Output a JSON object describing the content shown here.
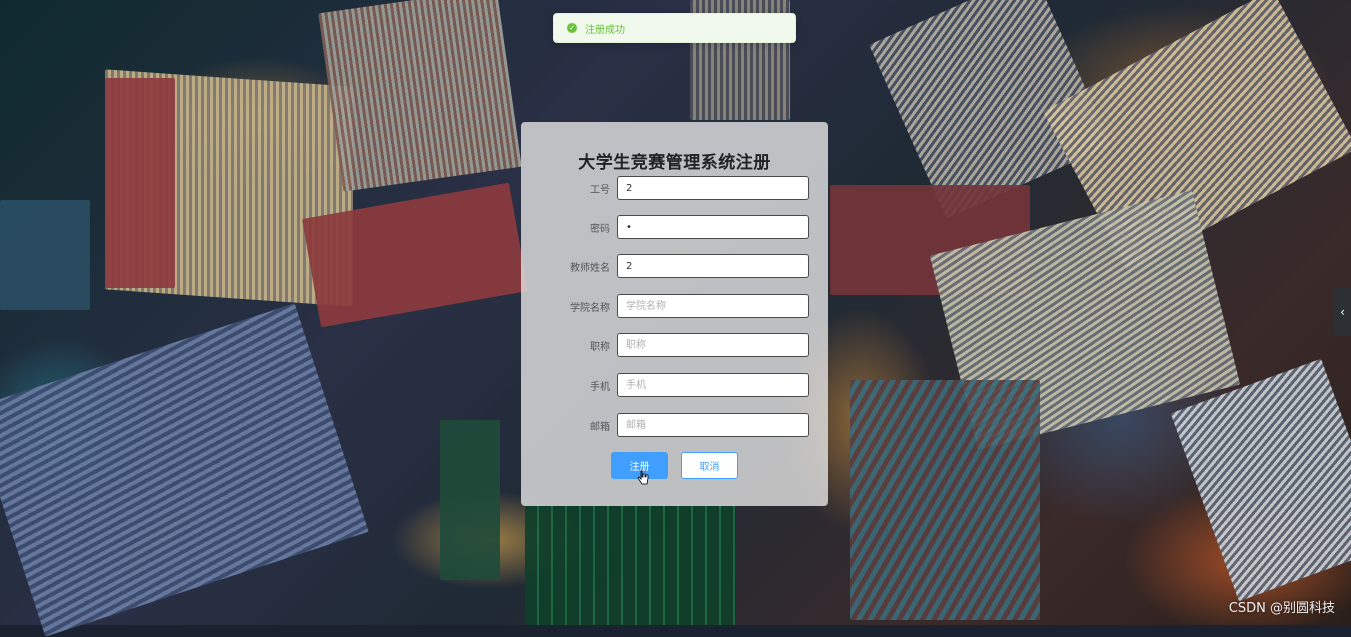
{
  "toast": {
    "type": "success",
    "message": "注册成功",
    "icon": "check-circle-icon",
    "color": "#67c23a"
  },
  "form": {
    "title": "大学生竞赛管理系统注册",
    "fields": [
      {
        "key": "gonghao",
        "label": "工号",
        "value": "2",
        "placeholder": ""
      },
      {
        "key": "mima",
        "label": "密码",
        "value": "•",
        "placeholder": ""
      },
      {
        "key": "jiaoshixingming",
        "label": "教师姓名",
        "value": "2",
        "placeholder": ""
      },
      {
        "key": "xueyuanmingcheng",
        "label": "学院名称",
        "value": "",
        "placeholder": "学院名称"
      },
      {
        "key": "zhicheng",
        "label": "职称",
        "value": "",
        "placeholder": "职称"
      },
      {
        "key": "shouji",
        "label": "手机",
        "value": "",
        "placeholder": "手机"
      },
      {
        "key": "youxiang",
        "label": "邮箱",
        "value": "",
        "placeholder": "邮箱"
      }
    ],
    "register_label": "注册",
    "cancel_label": "取消",
    "primary_color": "#409eff"
  },
  "side_toggle": {
    "icon": "chevron-left-icon",
    "glyph": "‹"
  },
  "watermark": "CSDN @别圆科技"
}
